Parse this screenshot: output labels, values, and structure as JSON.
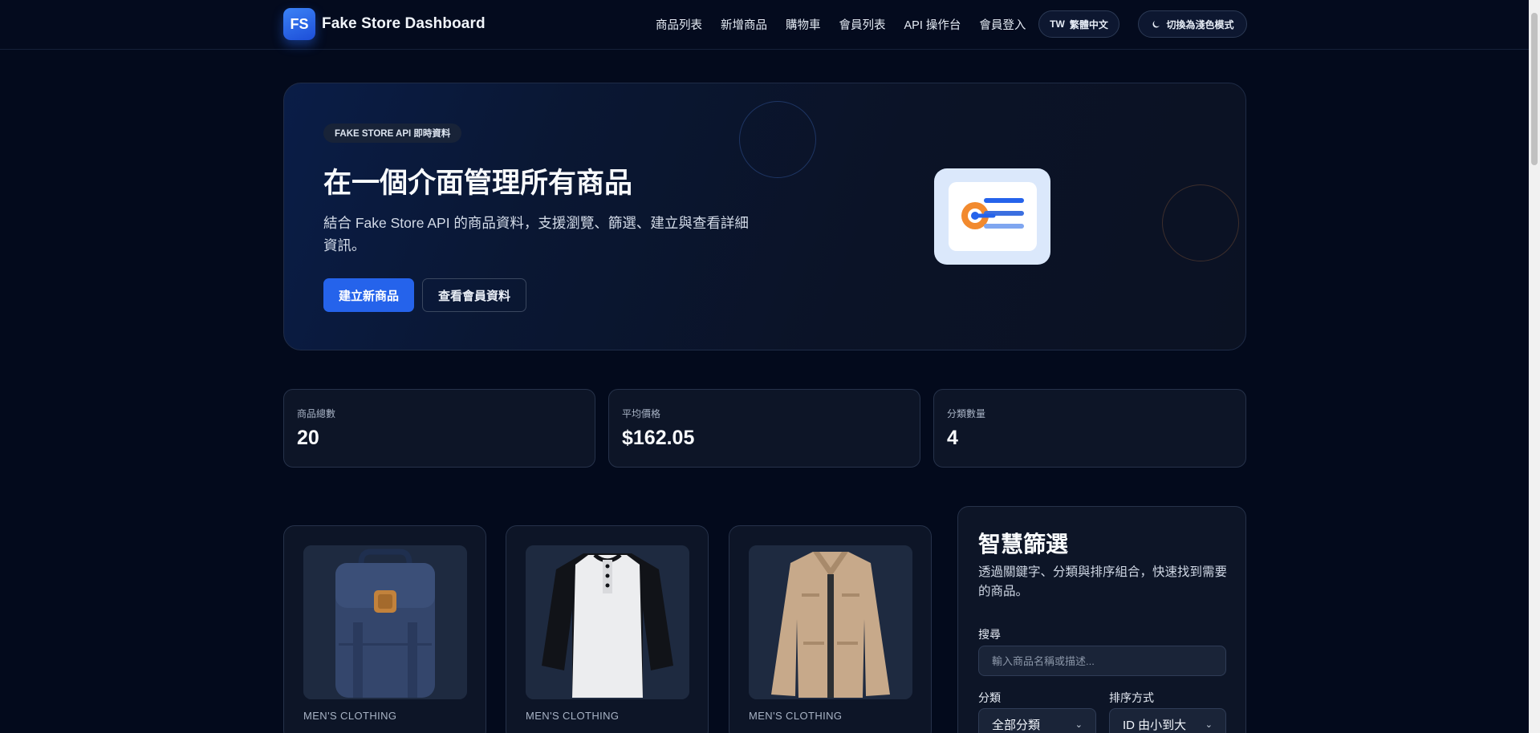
{
  "header": {
    "logo": "FS",
    "brand": "Fake Store Dashboard",
    "nav": [
      "商品列表",
      "新增商品",
      "購物車",
      "會員列表",
      "API 操作台",
      "會員登入"
    ],
    "lang_flag": "TW",
    "lang_label": "繁體中文",
    "theme_label": "切換為淺色模式"
  },
  "hero": {
    "badge": "FAKE STORE API 即時資料",
    "title": "在一個介面管理所有商品",
    "description": "結合 Fake Store API 的商品資料，支援瀏覽、篩選、建立與查看詳細資訊。",
    "primary_button": "建立新商品",
    "secondary_button": "查看會員資料"
  },
  "stats": [
    {
      "label": "商品總數",
      "value": "20"
    },
    {
      "label": "平均價格",
      "value": "$162.05"
    },
    {
      "label": "分類數量",
      "value": "4"
    }
  ],
  "products": [
    {
      "category": "MEN'S CLOTHING",
      "image": "backpack"
    },
    {
      "category": "MEN'S CLOTHING",
      "image": "raglan-tshirt"
    },
    {
      "category": "MEN'S CLOTHING",
      "image": "cotton-jacket"
    }
  ],
  "filter": {
    "title": "智慧篩選",
    "description": "透過關鍵字、分類與排序組合，快速找到需要的商品。",
    "search_label": "搜尋",
    "search_placeholder": "輸入商品名稱或描述...",
    "category_label": "分類",
    "category_value": "全部分類",
    "sort_label": "排序方式",
    "sort_value": "ID 由小到大"
  },
  "colors": {
    "background": "#030a1c",
    "accent": "#2563eb",
    "card": "#0d1527"
  }
}
